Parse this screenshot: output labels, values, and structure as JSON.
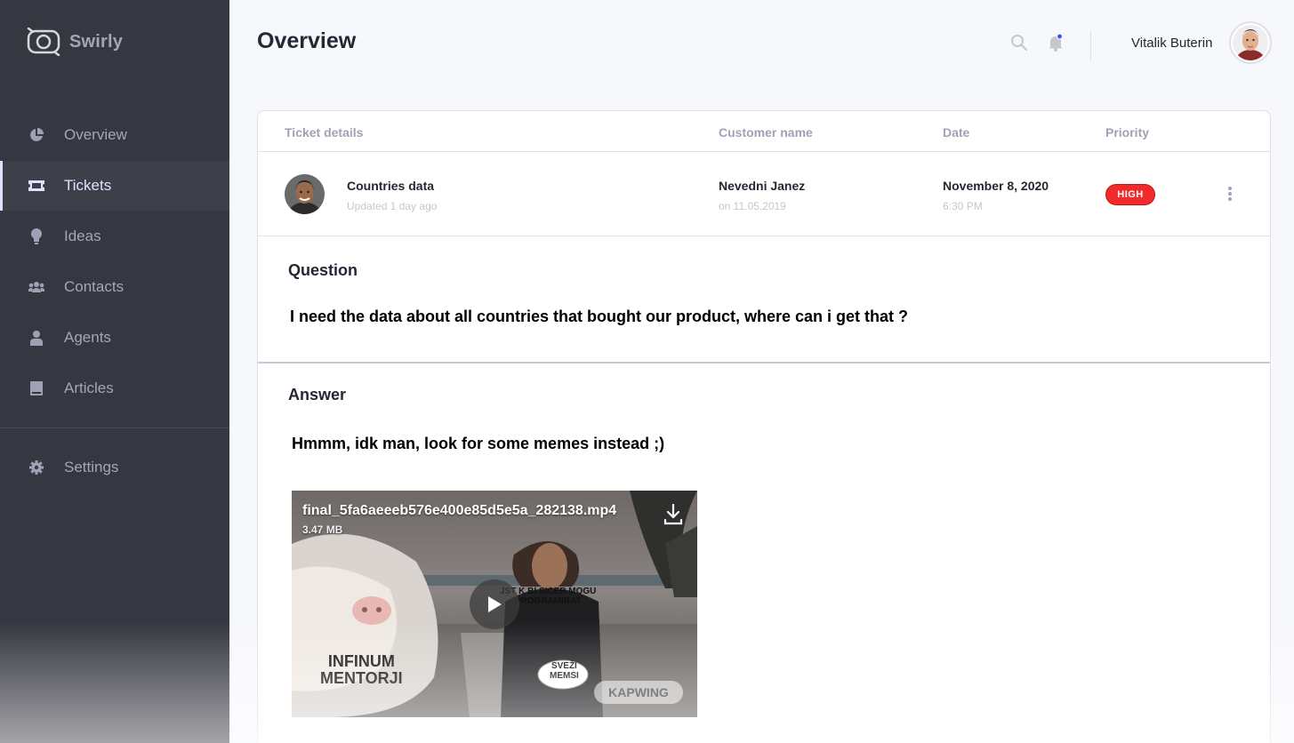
{
  "brand": {
    "name": "Swirly"
  },
  "sidebar": {
    "items": [
      {
        "label": "Overview",
        "icon": "pie-chart-icon"
      },
      {
        "label": "Tickets",
        "icon": "ticket-icon",
        "active": true
      },
      {
        "label": "Ideas",
        "icon": "lightbulb-icon"
      },
      {
        "label": "Contacts",
        "icon": "contacts-icon"
      },
      {
        "label": "Agents",
        "icon": "agent-icon"
      },
      {
        "label": "Articles",
        "icon": "book-icon"
      }
    ],
    "settings": {
      "label": "Settings",
      "icon": "gear-icon"
    }
  },
  "header": {
    "title": "Overview",
    "user_name": "Vitalik Buterin",
    "search_icon": "search-icon",
    "notification_icon": "bell-icon"
  },
  "table": {
    "columns": [
      "Ticket details",
      "Customer name",
      "Date",
      "Priority"
    ],
    "row": {
      "title": "Countries data",
      "updated": "Updated 1 day ago",
      "customer": "Nevedni Janez",
      "customer_date": "on 11.05.2019",
      "date": "November 8, 2020",
      "time": "6:30 PM",
      "priority": "HIGH"
    }
  },
  "question": {
    "heading": "Question",
    "text": "I need the data about all countries that bought our product, where can i get that ?"
  },
  "answer": {
    "heading": "Answer",
    "text": "Hmmm, idk man, look for some memes instead ;)",
    "video": {
      "filename": "final_5fa6aeeeb576e400e85d5e5a_282138.mp4",
      "size": "3.47 MB",
      "caption_left": "INFINUM\nMENTORJI",
      "caption_top": "JST K BI SICER MOGU\nPROGRAMIRAT",
      "caption_bubble": "SVEŽI\nMEMSI",
      "watermark": "KAPWING"
    }
  },
  "colors": {
    "sidebar_bg": "#363740",
    "sidebar_text": "#a4a6b3",
    "active_text": "#dde2ff",
    "priority_high": "#f12b2c",
    "page_bg": "#f7f8fc"
  }
}
